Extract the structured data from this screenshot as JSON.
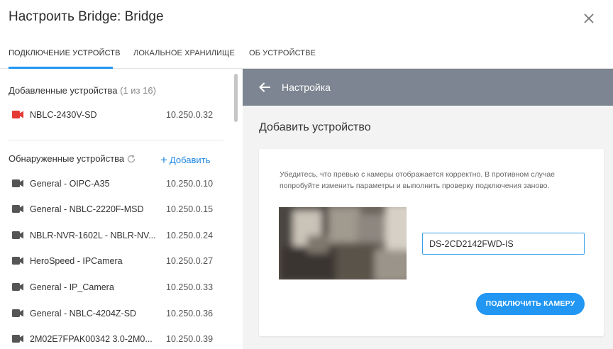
{
  "dialog": {
    "title": "Настроить Bridge: Bridge"
  },
  "tabs": [
    {
      "label": "ПОДКЛЮЧЕНИЕ УСТРОЙСТВ",
      "active": true
    },
    {
      "label": "ЛОКАЛЬНОЕ ХРАНИЛИЩЕ",
      "active": false
    },
    {
      "label": "ОБ УСТРОЙСТВЕ",
      "active": false
    }
  ],
  "added": {
    "title": "Добавленные устройства",
    "count": "(1 из 16)",
    "devices": [
      {
        "name": "NBLC-2430V-SD",
        "ip": "10.250.0.32",
        "icon": "camera-icon",
        "color": "#e53935"
      }
    ]
  },
  "discovered": {
    "title": "Обнаруженные устройства",
    "add_label": "Добавить",
    "devices": [
      {
        "name": "General - OIPC-A35",
        "ip": "10.250.0.10"
      },
      {
        "name": "General - NBLC-2220F-MSD",
        "ip": "10.250.0.15"
      },
      {
        "name": "NBLR-NVR-1602L - NBLR-NV...",
        "ip": "10.250.0.24"
      },
      {
        "name": "HeroSpeed - IPCamera",
        "ip": "10.250.0.27"
      },
      {
        "name": "General - IP_Camera",
        "ip": "10.250.0.33"
      },
      {
        "name": "General - NBLC-4204Z-SD",
        "ip": "10.250.0.36"
      },
      {
        "name": "2M02E7FPAK00342 3.0-2M0...",
        "ip": "10.250.0.39"
      }
    ]
  },
  "panel": {
    "header_title": "Настройка",
    "add_title": "Добавить устройство",
    "hint": "Убедитесь, что превью с камеры отображается корректно. В противном случае попробуйте изменить параметры и выполнить проверку подключения заново.",
    "model_value": "DS-2CD2142FWD-IS",
    "connect_label": "ПОДКЛЮЧИТЬ КАМЕРУ"
  },
  "colors": {
    "accent": "#2196f3",
    "header_bg": "#7c8591",
    "added_icon": "#e53935",
    "device_icon": "#555555"
  }
}
